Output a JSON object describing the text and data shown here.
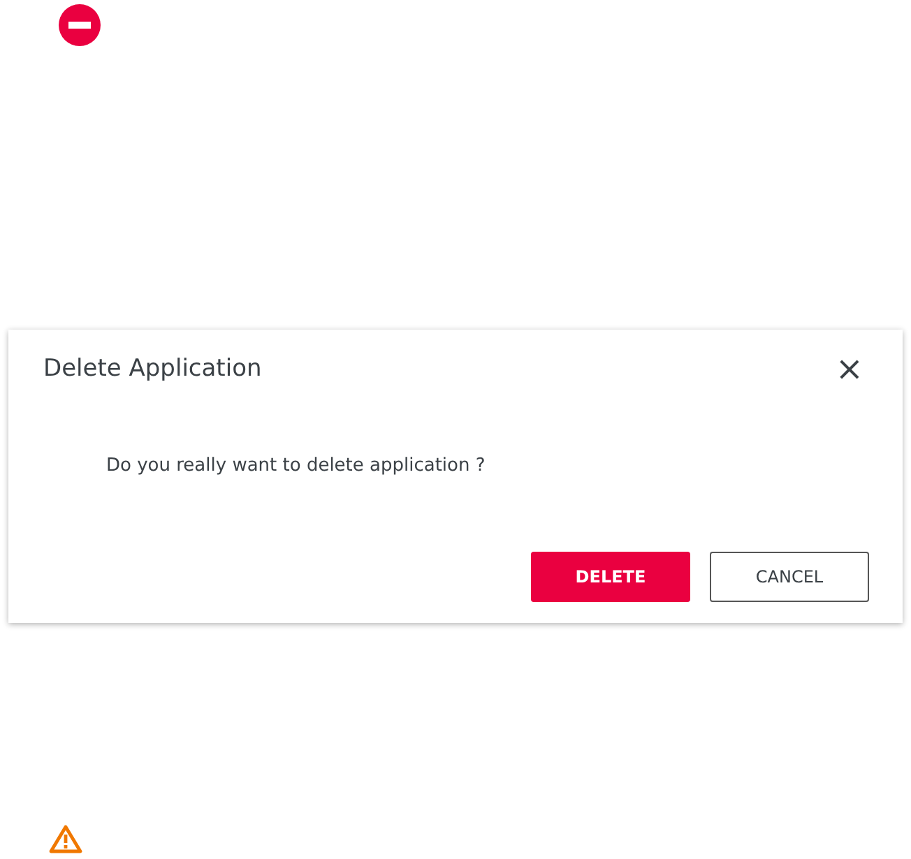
{
  "dialog": {
    "title": "Delete Application",
    "close_label": "×",
    "message": "Do you really want to delete application ?",
    "buttons": [
      {
        "label": "DELETE",
        "kind": "primary"
      },
      {
        "label": "CANCEL",
        "kind": "secondary"
      }
    ]
  }
}
